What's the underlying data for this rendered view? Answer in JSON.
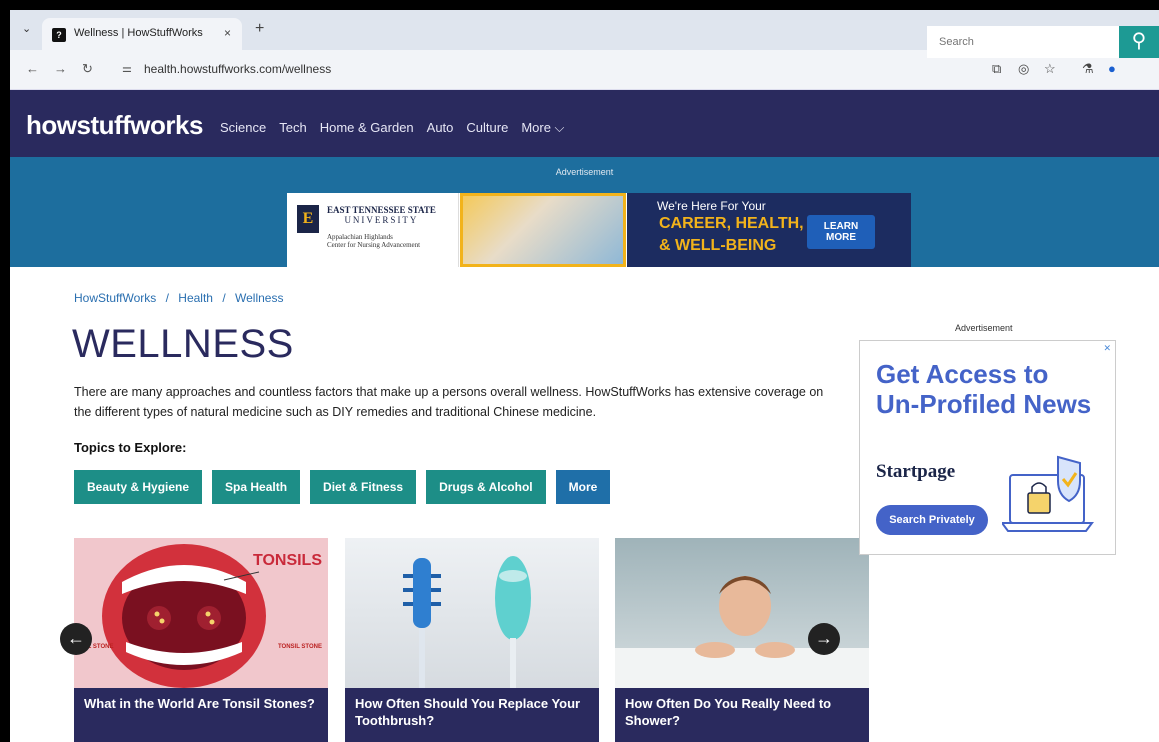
{
  "browser": {
    "tab_title": "Wellness | HowStuffWorks",
    "tab_close": "×",
    "new_tab": "+",
    "url": "health.howstuffworks.com/wellness"
  },
  "site": {
    "logo": "howstuffworks",
    "nav": [
      "Science",
      "Tech",
      "Home & Garden",
      "Auto",
      "Culture",
      "More ⌵"
    ],
    "search_placeholder": "Search"
  },
  "top_ad": {
    "label": "Advertisement",
    "school_name_line1": "EAST TENNESSEE STATE",
    "school_name_line2": "UNIVERSITY",
    "school_sub_line1": "Appalachian Highlands",
    "school_sub_line2": "Center for Nursing Advancement",
    "line1": "We're Here For Your",
    "line2": "CAREER, HEALTH,",
    "line3": "& WELL-BEING",
    "cta_line1": "LEARN",
    "cta_line2": "MORE"
  },
  "breadcrumb": [
    "HowStuffWorks",
    "Health",
    "Wellness"
  ],
  "breadcrumb_separator": "/",
  "page_title": "WELLNESS",
  "intro": "There are many approaches and countless factors that make up a persons overall wellness. HowStuffWorks has extensive coverage on the different types of natural medicine such as DIY remedies and traditional Chinese medicine.",
  "topics_label": "Topics to Explore:",
  "topics": [
    "Beauty & Hygiene",
    "Spa Health",
    "Diet & Fitness",
    "Drugs & Alcohol",
    "More"
  ],
  "cards": [
    {
      "title": "What in the World Are Tonsil Stones?",
      "image_label": "TONSILS",
      "stone_left": "SIL STONE",
      "stone_right": "TONSIL STONE"
    },
    {
      "title": "How Often Should You Replace Your Toothbrush?"
    },
    {
      "title": "How Often Do You Really Need to Shower?"
    }
  ],
  "carousel": {
    "prev": "←",
    "next": "→"
  },
  "side_ad": {
    "label": "Advertisement",
    "headline": "Get Access to Un-Profiled News",
    "brand": "Startpage",
    "cta": "Search Privately"
  },
  "colors": {
    "header_bg": "#2a2a5e",
    "ad_band_bg": "#1d6e9e",
    "topic_teal": "#1d8e87",
    "topic_more": "#1f6fa8",
    "link_blue": "#2a6fb0"
  }
}
